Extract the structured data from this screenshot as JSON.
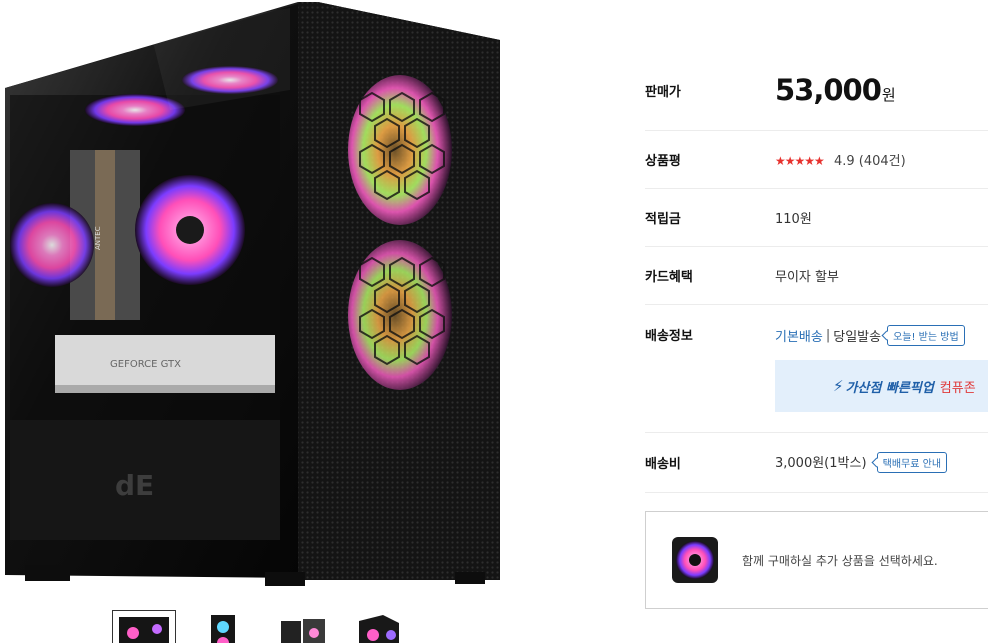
{
  "gallery": {
    "main_image": "pc-case-product-photo",
    "case_badge_text": "GEFORCE GTX",
    "thumbnails": [
      {
        "name": "thumbnail-front",
        "active": true
      },
      {
        "name": "thumbnail-fans",
        "active": false
      },
      {
        "name": "thumbnail-open",
        "active": false
      },
      {
        "name": "thumbnail-angle",
        "active": false
      }
    ]
  },
  "info": {
    "price": {
      "label": "판매가",
      "amount": "53,000",
      "unit": "원"
    },
    "rating": {
      "label": "상품평",
      "stars": "★★★★★",
      "score": "4.9",
      "count": "(404건)"
    },
    "points": {
      "label": "적립금",
      "value": "110원"
    },
    "card": {
      "label": "카드혜택",
      "value": "무이자 할부"
    },
    "shipping": {
      "label": "배송정보",
      "basic": "기본배송",
      "separator": "|",
      "same_day": "당일발송",
      "tag": "오늘! 받는 방법",
      "pickup_icon": "lightning-icon",
      "pickup_title": "가산점 빠른픽업",
      "pickup_sub": "컴퓨존"
    },
    "fee": {
      "label": "배송비",
      "value": "3,000원(1박스)",
      "tag": "택배무료 안내"
    }
  },
  "addon": {
    "text": "함께 구매하실 추가 상품을 선택하세요."
  },
  "colors": {
    "accent_blue": "#2a6fb5",
    "star_red": "#e7322e",
    "pickup_bg": "#e3effb"
  }
}
